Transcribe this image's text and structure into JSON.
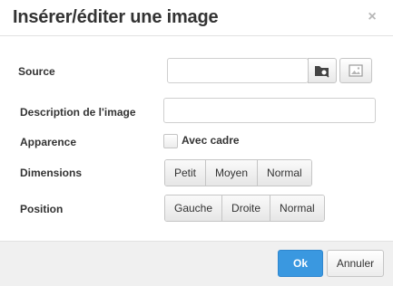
{
  "dialog": {
    "title": "Insérer/éditer une image",
    "close_glyph": "×"
  },
  "form": {
    "source_label": "Source",
    "source_value": "",
    "browse_icon": "folder-search-icon",
    "image_icon": "image-icon",
    "description_label": "Description de l'image",
    "description_value": "",
    "appearance_label": "Apparence",
    "frame_checkbox_label": "Avec cadre",
    "dimensions_label": "Dimensions",
    "dimensions_options": [
      "Petit",
      "Moyen",
      "Normal"
    ],
    "position_label": "Position",
    "position_options": [
      "Gauche",
      "Droite",
      "Normal"
    ]
  },
  "footer": {
    "ok_label": "Ok",
    "cancel_label": "Annuler"
  },
  "colors": {
    "primary": "#3a98e0",
    "footer_bg": "#f0f0f0"
  }
}
